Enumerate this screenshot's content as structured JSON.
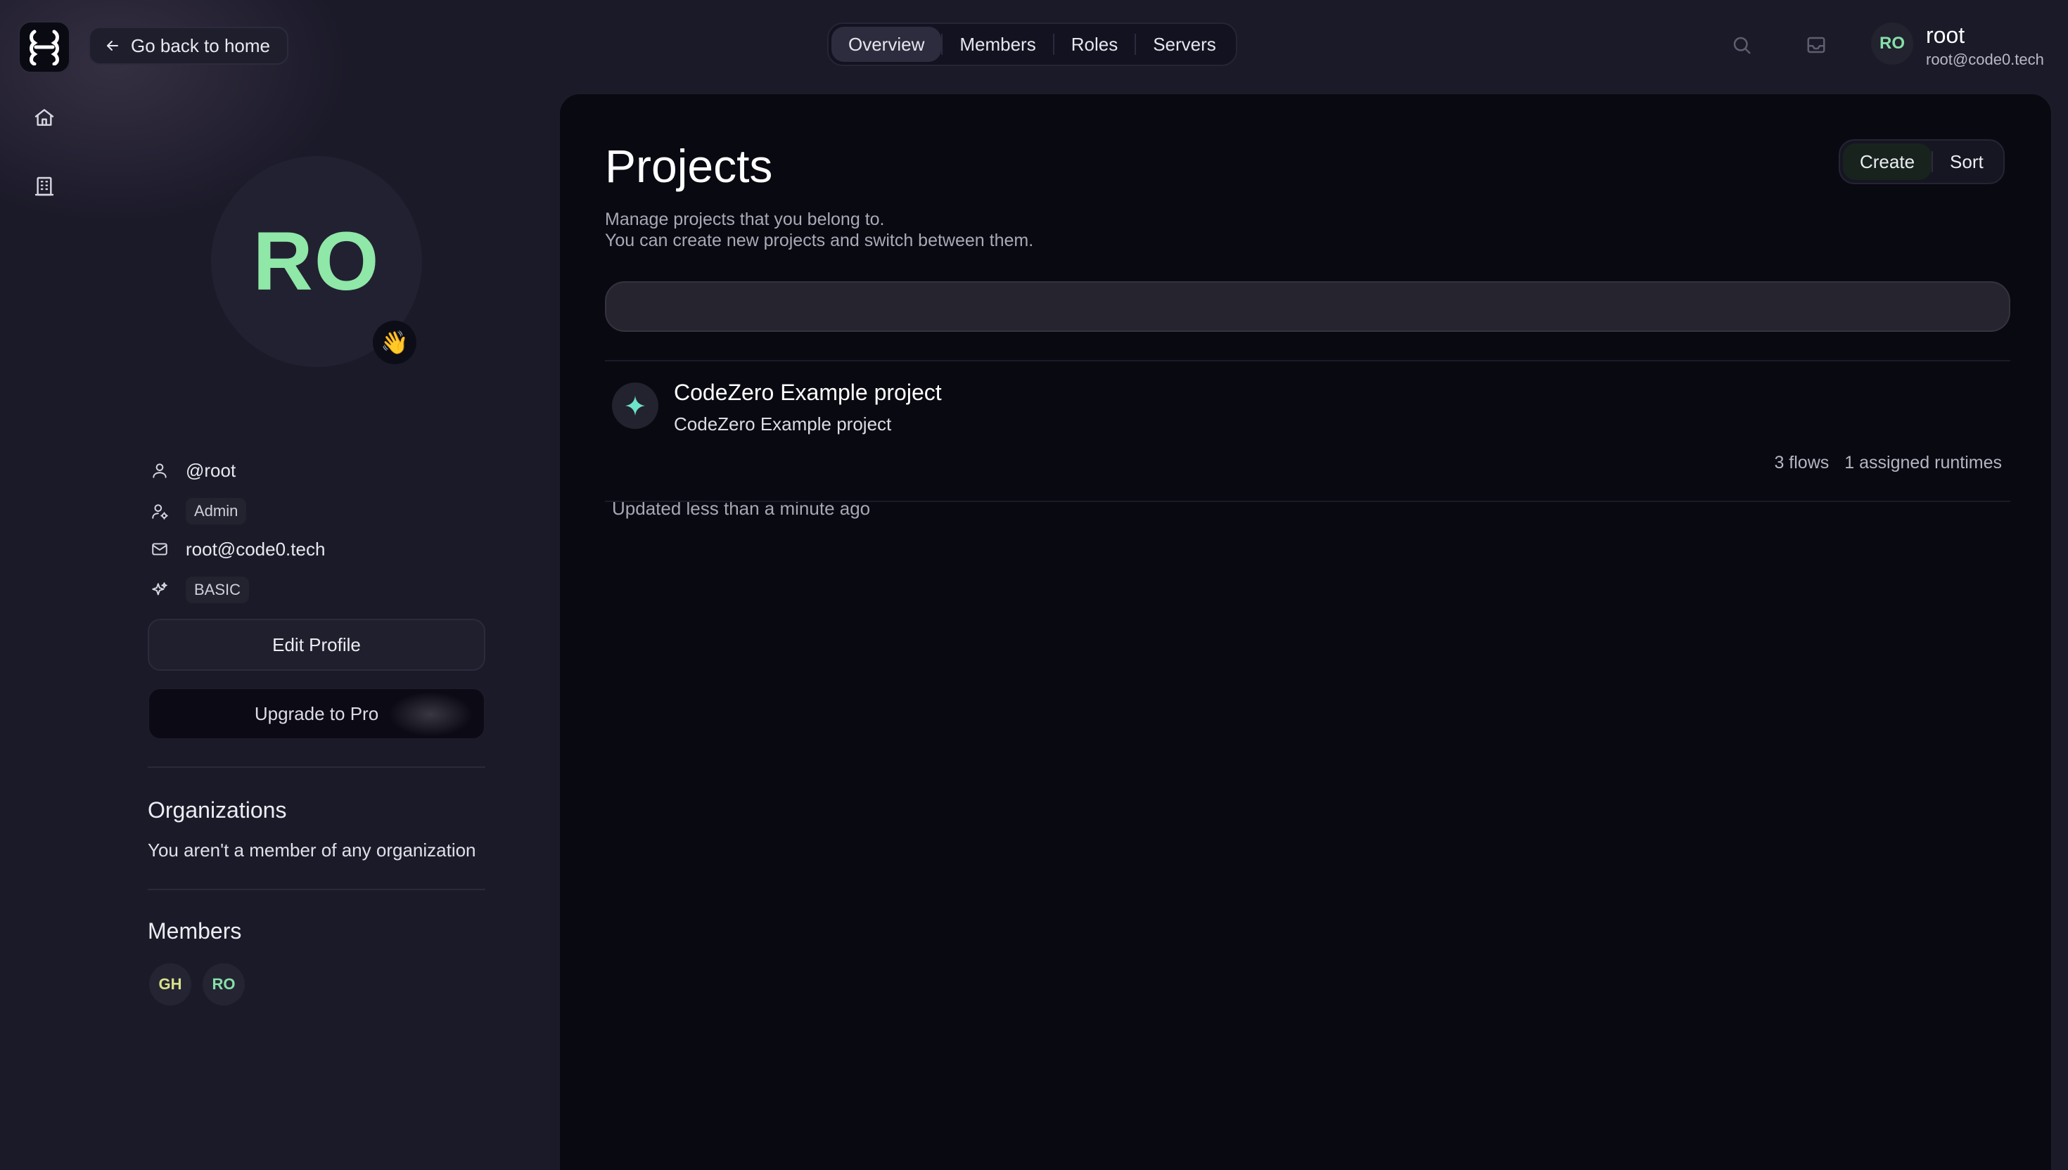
{
  "nav": {
    "back_label": "Go back to home",
    "tabs": [
      {
        "label": "Overview",
        "active": true
      },
      {
        "label": "Members",
        "active": false
      },
      {
        "label": "Roles",
        "active": false
      },
      {
        "label": "Servers",
        "active": false
      }
    ]
  },
  "user": {
    "initials": "RO",
    "name": "root",
    "email": "root@code0.tech"
  },
  "profile": {
    "initials": "RO",
    "wave_emoji": "👋",
    "username": "@root",
    "role": "Admin",
    "email": "root@code0.tech",
    "plan": "BASIC",
    "edit_label": "Edit Profile",
    "upgrade_label": "Upgrade to Pro"
  },
  "organizations": {
    "title": "Organizations",
    "empty_text": "You aren't a member of any organization"
  },
  "members": {
    "title": "Members",
    "chips": [
      {
        "initials": "GH",
        "color": "#d9e28a"
      },
      {
        "initials": "RO",
        "color": "#86e0a8"
      }
    ]
  },
  "projects_page": {
    "title": "Projects",
    "desc_line1": "Manage projects that you belong to.",
    "desc_line2": "You can create new projects and switch between them.",
    "create_label": "Create",
    "sort_label": "Sort",
    "search_value": "",
    "search_placeholder": ""
  },
  "projects": [
    {
      "title": "CodeZero Example project",
      "subtitle": "CodeZero Example project",
      "flows": "3 flows",
      "runtimes": "1 assigned runtimes",
      "updated": "Updated less than a minute ago"
    }
  ],
  "colors": {
    "accent_green": "#86e0a8",
    "accent_yellow": "#d9e28a",
    "project_icon": "#6fe3c8"
  },
  "icons": {
    "logo": "codezero-logo-icon",
    "rail": [
      "home-icon",
      "building-icon"
    ],
    "back": "arrow-left-icon",
    "search": "search-icon",
    "inbox": "inbox-icon"
  }
}
